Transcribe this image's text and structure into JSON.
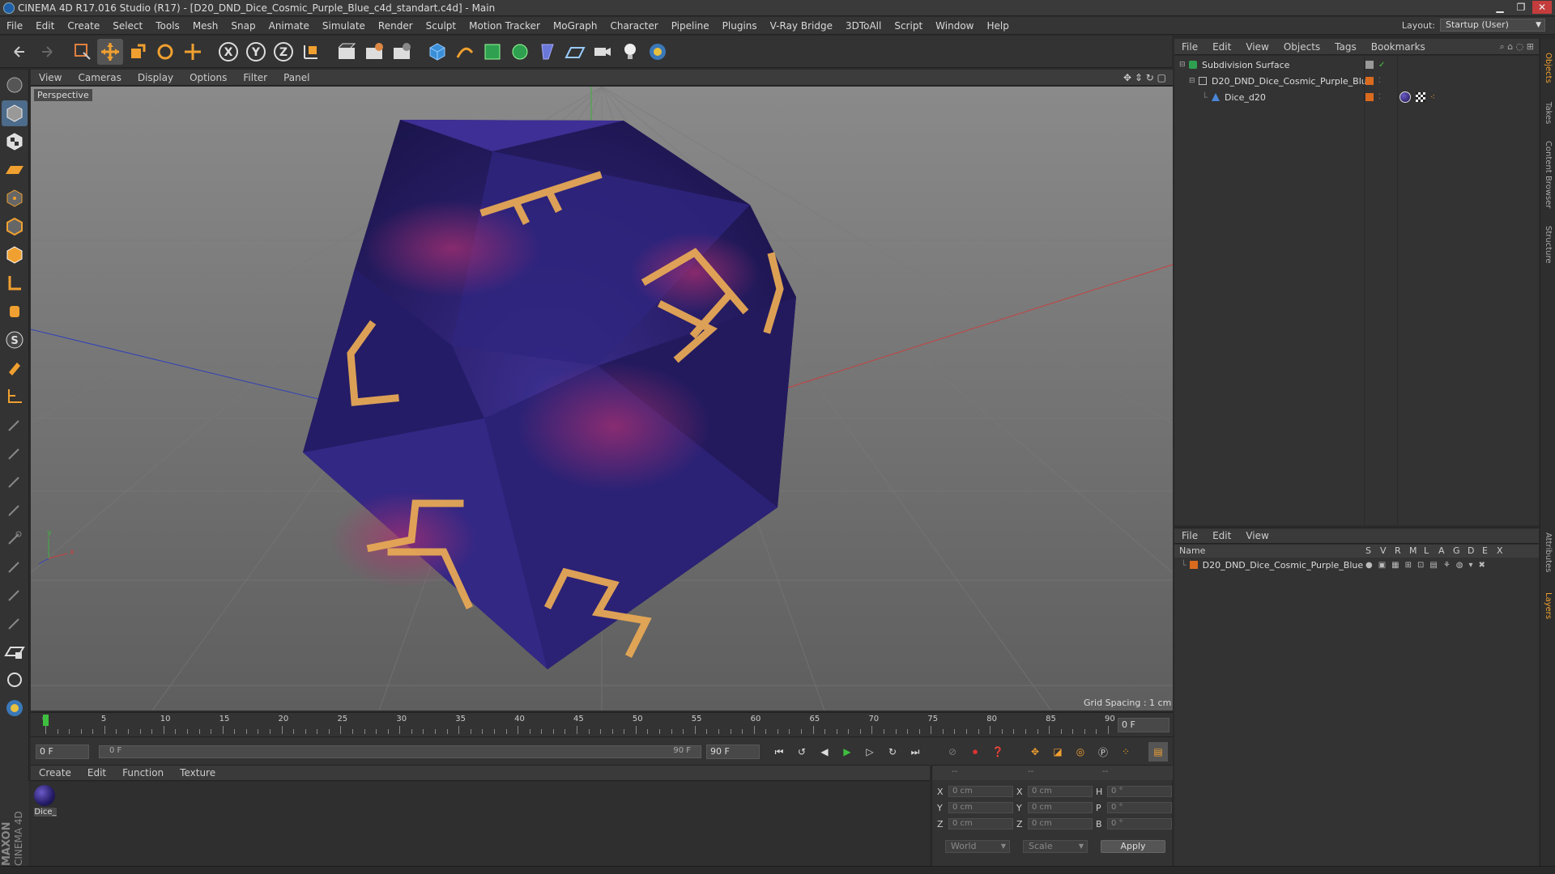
{
  "window": {
    "title": "CINEMA 4D R17.016 Studio (R17) - [D20_DND_Dice_Cosmic_Purple_Blue_c4d_standart.c4d] - Main",
    "minimize": "▁",
    "maximize": "❐",
    "close": "✕"
  },
  "menubar": {
    "items": [
      "File",
      "Edit",
      "Create",
      "Select",
      "Tools",
      "Mesh",
      "Snap",
      "Animate",
      "Simulate",
      "Render",
      "Sculpt",
      "Motion Tracker",
      "MoGraph",
      "Character",
      "Pipeline",
      "Plugins",
      "V-Ray Bridge",
      "3DToAll",
      "Script",
      "Window",
      "Help"
    ],
    "layout_label": "Layout:",
    "layout_value": "Startup (User)"
  },
  "viewport": {
    "menu": [
      "View",
      "Cameras",
      "Display",
      "Options",
      "Filter",
      "Panel"
    ],
    "label": "Perspective",
    "grid_spacing": "Grid Spacing : 1 cm",
    "axis_y": "y",
    "axis_x": "x"
  },
  "timeline": {
    "ticks": [
      "0",
      "5",
      "10",
      "15",
      "20",
      "25",
      "30",
      "35",
      "40",
      "45",
      "50",
      "55",
      "60",
      "65",
      "70",
      "75",
      "80",
      "85",
      "90"
    ],
    "current_frame": "0 F",
    "start_field": "0 F",
    "range_start": "0 F",
    "range_end": "90 F",
    "end_field": "90 F"
  },
  "material_manager": {
    "menu": [
      "Create",
      "Edit",
      "Function",
      "Texture"
    ],
    "materials": [
      {
        "name": "Dice_"
      }
    ]
  },
  "branding": {
    "maxon": "MAXON",
    "cinema": "CINEMA 4D"
  },
  "coordinates": {
    "header": [
      "--",
      "--",
      "--"
    ],
    "rows": [
      {
        "l1": "X",
        "v1": "0 cm",
        "l2": "X",
        "v2": "0 cm",
        "l3": "H",
        "v3": "0 °"
      },
      {
        "l1": "Y",
        "v1": "0 cm",
        "l2": "Y",
        "v2": "0 cm",
        "l3": "P",
        "v3": "0 °"
      },
      {
        "l1": "Z",
        "v1": "0 cm",
        "l2": "Z",
        "v2": "0 cm",
        "l3": "B",
        "v3": "0 °"
      }
    ],
    "space": "World",
    "mode": "Scale",
    "apply": "Apply"
  },
  "object_manager": {
    "menu": [
      "File",
      "Edit",
      "View",
      "Objects",
      "Tags",
      "Bookmarks"
    ],
    "objects": [
      {
        "name": "Subdivision Surface"
      },
      {
        "name": "D20_DND_Dice_Cosmic_Purple_Blue"
      },
      {
        "name": "Dice_d20"
      }
    ]
  },
  "layer_manager": {
    "menu": [
      "File",
      "Edit",
      "View"
    ],
    "columns": [
      "Name",
      "S",
      "V",
      "R",
      "M",
      "L",
      "A",
      "G",
      "D",
      "E",
      "X"
    ],
    "layers": [
      {
        "name": "D20_DND_Dice_Cosmic_Purple_Blue"
      }
    ]
  },
  "right_tabs": [
    "Objects",
    "Takes",
    "Content Browser",
    "Structure",
    "Attributes",
    "Layers"
  ],
  "colors": {
    "accent": "#4d6b8a",
    "layer_orange": "#d96a1e",
    "dice_purple": "#2a1f6b",
    "numeral_gold": "#e6a855"
  }
}
